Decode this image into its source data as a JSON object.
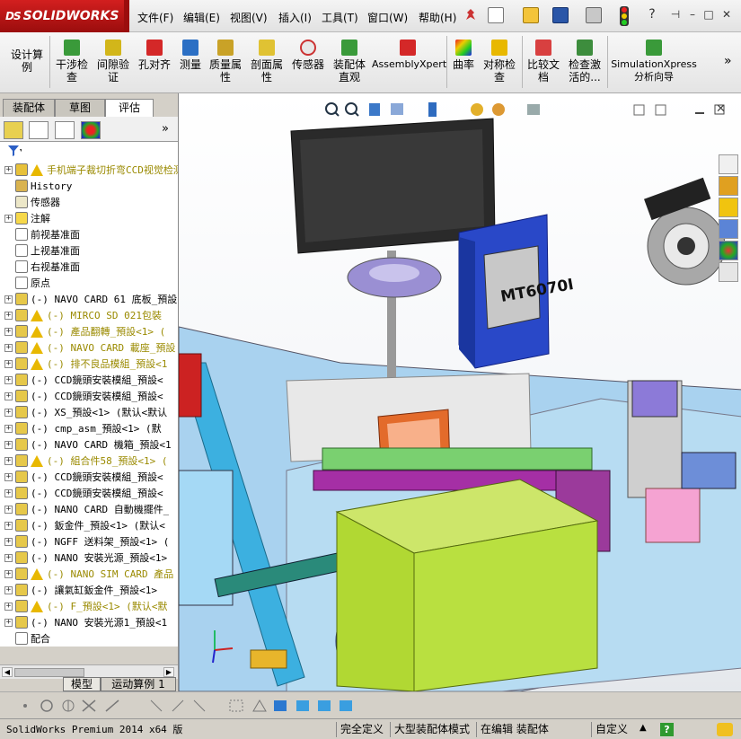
{
  "app": {
    "logo_ds": "DS",
    "logo_text": "SOLIDWORKS"
  },
  "menu": [
    "文件(F)",
    "编辑(E)",
    "视图(V)",
    "插入(I)",
    "工具(T)",
    "窗口(W)",
    "帮助(H)"
  ],
  "toolbar_glyphs": {
    "help": "?",
    "pin": "⊣",
    "min": "–",
    "max": "□",
    "close": "✕"
  },
  "ribbon": [
    {
      "name": "设计算例",
      "label": "设计算\n例",
      "icon": "design-study-icon"
    },
    {
      "name": "干涉检查",
      "label": "干涉检\n查",
      "icon": "interference-check-icon"
    },
    {
      "name": "间隙验证",
      "label": "间隙验\n证",
      "icon": "clearance-verification-icon"
    },
    {
      "name": "孔对齐",
      "label": "孔对齐",
      "icon": "hole-alignment-icon"
    },
    {
      "name": "测量",
      "label": "测量",
      "icon": "measure-icon"
    },
    {
      "name": "质量属性",
      "label": "质量属\n性",
      "icon": "mass-properties-icon"
    },
    {
      "name": "剖面属性",
      "label": "剖面属\n性",
      "icon": "section-properties-icon"
    },
    {
      "name": "传感器",
      "label": "传感器",
      "icon": "sensor-icon"
    },
    {
      "name": "装配体直观",
      "label": "装配体\n直观",
      "icon": "assembly-visualization-icon"
    },
    {
      "name": "AssemblyXpert",
      "label": "AssemblyXpert",
      "icon": "assemblyxpert-icon"
    },
    {
      "name": "曲率",
      "label": "曲率",
      "icon": "curvature-icon"
    },
    {
      "name": "对称检查",
      "label": "对称检\n查",
      "icon": "symmetry-check-icon"
    },
    {
      "name": "比较文档",
      "label": "比较文\n档",
      "icon": "compare-documents-icon"
    },
    {
      "name": "检查激活的",
      "label": "检查激\n活的...",
      "icon": "check-active-icon"
    },
    {
      "name": "SimulationXpress",
      "label": "SimulationXpress\n分析向导",
      "icon": "simulationxpress-icon"
    }
  ],
  "ribbon_more": "»",
  "tabs": [
    "装配体",
    "草图",
    "评估"
  ],
  "panel_more": "»",
  "tree": [
    {
      "label": "手机端子裁切折弯CCD视觉检测",
      "type": "root",
      "warn": true,
      "yellow": true
    },
    {
      "label": "History",
      "type": "history",
      "indent": 1
    },
    {
      "label": "传感器",
      "type": "sensor",
      "indent": 1
    },
    {
      "label": "注解",
      "type": "annotation",
      "indent": 1,
      "expand": true
    },
    {
      "label": "前视基准面",
      "type": "plane",
      "indent": 1
    },
    {
      "label": "上视基准面",
      "type": "plane",
      "indent": 1
    },
    {
      "label": "右视基准面",
      "type": "plane",
      "indent": 1
    },
    {
      "label": "原点",
      "type": "origin",
      "indent": 1
    },
    {
      "label": "(-) NAVO CARD 61 底板_預設",
      "type": "part",
      "expand": true
    },
    {
      "label": "(-) MIRCO SD  021包裝",
      "type": "part",
      "expand": true,
      "warn": true,
      "yellow": true
    },
    {
      "label": "(-) 產品翻轉_預設<1> (",
      "type": "part",
      "expand": true,
      "warn": true,
      "yellow": true
    },
    {
      "label": "(-) NAVO CARD 載座_預設",
      "type": "part",
      "expand": true,
      "warn": true,
      "yellow": true
    },
    {
      "label": "(-) 排不良品模組_預設<1",
      "type": "part",
      "expand": true,
      "warn": true,
      "yellow": true
    },
    {
      "label": "(-) CCD鏡頭安裝模組_預設<",
      "type": "part",
      "expand": true
    },
    {
      "label": "(-) CCD鏡頭安裝模組_預設<",
      "type": "part",
      "expand": true
    },
    {
      "label": "(-) XS_預設<1> (默认<默认",
      "type": "part",
      "expand": true
    },
    {
      "label": "(-) cmp_asm_預設<1> (默",
      "type": "part",
      "expand": true
    },
    {
      "label": "(-) NAVO CARD 機箱_預設<1",
      "type": "part",
      "expand": true
    },
    {
      "label": "(-) 組合件58_預設<1> (",
      "type": "part",
      "expand": true,
      "warn": true,
      "yellow": true
    },
    {
      "label": "(-) CCD鏡頭安裝模組_預設<",
      "type": "part",
      "expand": true
    },
    {
      "label": "(-) CCD鏡頭安裝模組_預設<",
      "type": "part",
      "expand": true
    },
    {
      "label": "(-) NANO CARD 自動機擺件_",
      "type": "part",
      "expand": true
    },
    {
      "label": "(-) 鈑金件_預設<1> (默认<",
      "type": "part",
      "expand": true
    },
    {
      "label": "(-) NGFF 送料架_預設<1> (",
      "type": "part",
      "expand": true
    },
    {
      "label": "(-) NANO 安裝光源_預設<1>",
      "type": "part",
      "expand": true
    },
    {
      "label": "(-) NANO SIM CARD 產品",
      "type": "part",
      "expand": true,
      "warn": true,
      "yellow": true
    },
    {
      "label": "(-) 讓氣缸鈑金件_預設<1>",
      "type": "part",
      "expand": true
    },
    {
      "label": "(-) F_預設<1> (默认<默",
      "type": "part",
      "expand": true,
      "warn": true,
      "yellow": true
    },
    {
      "label": "(-) NANO 安裝光源1_預設<1",
      "type": "part",
      "expand": true
    },
    {
      "label": "配合",
      "type": "mates",
      "indent": 0
    }
  ],
  "bottom_tabs": [
    "模型",
    "运动算例 1"
  ],
  "viewport": {
    "monitor_label": "MT6070I"
  },
  "status": {
    "version": "SolidWorks Premium 2014 x64 版",
    "state": "完全定义",
    "mode": "大型装配体模式",
    "editing": "在编辑 装配体",
    "units": "自定义"
  },
  "colors": {
    "accent": "#c8102e",
    "warning": "#e8b800",
    "tree_yellow": "#9a8a00"
  }
}
